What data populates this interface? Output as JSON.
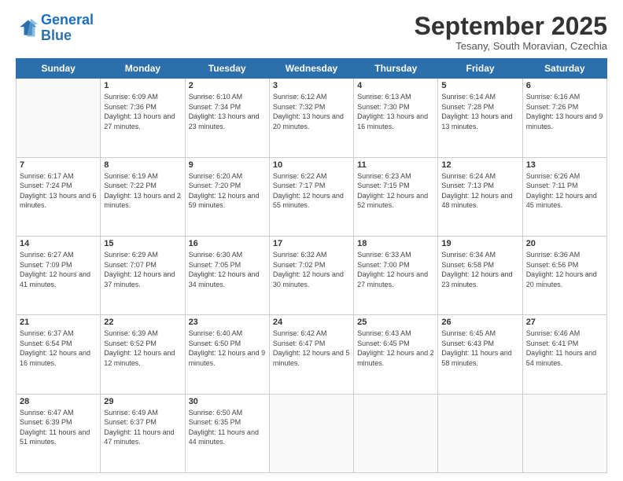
{
  "header": {
    "logo_line1": "General",
    "logo_line2": "Blue",
    "month": "September 2025",
    "location": "Tesany, South Moravian, Czechia"
  },
  "weekdays": [
    "Sunday",
    "Monday",
    "Tuesday",
    "Wednesday",
    "Thursday",
    "Friday",
    "Saturday"
  ],
  "weeks": [
    [
      {
        "day": "",
        "empty": true
      },
      {
        "day": "1",
        "sunrise": "Sunrise: 6:09 AM",
        "sunset": "Sunset: 7:36 PM",
        "daylight": "Daylight: 13 hours and 27 minutes."
      },
      {
        "day": "2",
        "sunrise": "Sunrise: 6:10 AM",
        "sunset": "Sunset: 7:34 PM",
        "daylight": "Daylight: 13 hours and 23 minutes."
      },
      {
        "day": "3",
        "sunrise": "Sunrise: 6:12 AM",
        "sunset": "Sunset: 7:32 PM",
        "daylight": "Daylight: 13 hours and 20 minutes."
      },
      {
        "day": "4",
        "sunrise": "Sunrise: 6:13 AM",
        "sunset": "Sunset: 7:30 PM",
        "daylight": "Daylight: 13 hours and 16 minutes."
      },
      {
        "day": "5",
        "sunrise": "Sunrise: 6:14 AM",
        "sunset": "Sunset: 7:28 PM",
        "daylight": "Daylight: 13 hours and 13 minutes."
      },
      {
        "day": "6",
        "sunrise": "Sunrise: 6:16 AM",
        "sunset": "Sunset: 7:26 PM",
        "daylight": "Daylight: 13 hours and 9 minutes."
      }
    ],
    [
      {
        "day": "7",
        "sunrise": "Sunrise: 6:17 AM",
        "sunset": "Sunset: 7:24 PM",
        "daylight": "Daylight: 13 hours and 6 minutes."
      },
      {
        "day": "8",
        "sunrise": "Sunrise: 6:19 AM",
        "sunset": "Sunset: 7:22 PM",
        "daylight": "Daylight: 13 hours and 2 minutes."
      },
      {
        "day": "9",
        "sunrise": "Sunrise: 6:20 AM",
        "sunset": "Sunset: 7:20 PM",
        "daylight": "Daylight: 12 hours and 59 minutes."
      },
      {
        "day": "10",
        "sunrise": "Sunrise: 6:22 AM",
        "sunset": "Sunset: 7:17 PM",
        "daylight": "Daylight: 12 hours and 55 minutes."
      },
      {
        "day": "11",
        "sunrise": "Sunrise: 6:23 AM",
        "sunset": "Sunset: 7:15 PM",
        "daylight": "Daylight: 12 hours and 52 minutes."
      },
      {
        "day": "12",
        "sunrise": "Sunrise: 6:24 AM",
        "sunset": "Sunset: 7:13 PM",
        "daylight": "Daylight: 12 hours and 48 minutes."
      },
      {
        "day": "13",
        "sunrise": "Sunrise: 6:26 AM",
        "sunset": "Sunset: 7:11 PM",
        "daylight": "Daylight: 12 hours and 45 minutes."
      }
    ],
    [
      {
        "day": "14",
        "sunrise": "Sunrise: 6:27 AM",
        "sunset": "Sunset: 7:09 PM",
        "daylight": "Daylight: 12 hours and 41 minutes."
      },
      {
        "day": "15",
        "sunrise": "Sunrise: 6:29 AM",
        "sunset": "Sunset: 7:07 PM",
        "daylight": "Daylight: 12 hours and 37 minutes."
      },
      {
        "day": "16",
        "sunrise": "Sunrise: 6:30 AM",
        "sunset": "Sunset: 7:05 PM",
        "daylight": "Daylight: 12 hours and 34 minutes."
      },
      {
        "day": "17",
        "sunrise": "Sunrise: 6:32 AM",
        "sunset": "Sunset: 7:02 PM",
        "daylight": "Daylight: 12 hours and 30 minutes."
      },
      {
        "day": "18",
        "sunrise": "Sunrise: 6:33 AM",
        "sunset": "Sunset: 7:00 PM",
        "daylight": "Daylight: 12 hours and 27 minutes."
      },
      {
        "day": "19",
        "sunrise": "Sunrise: 6:34 AM",
        "sunset": "Sunset: 6:58 PM",
        "daylight": "Daylight: 12 hours and 23 minutes."
      },
      {
        "day": "20",
        "sunrise": "Sunrise: 6:36 AM",
        "sunset": "Sunset: 6:56 PM",
        "daylight": "Daylight: 12 hours and 20 minutes."
      }
    ],
    [
      {
        "day": "21",
        "sunrise": "Sunrise: 6:37 AM",
        "sunset": "Sunset: 6:54 PM",
        "daylight": "Daylight: 12 hours and 16 minutes."
      },
      {
        "day": "22",
        "sunrise": "Sunrise: 6:39 AM",
        "sunset": "Sunset: 6:52 PM",
        "daylight": "Daylight: 12 hours and 12 minutes."
      },
      {
        "day": "23",
        "sunrise": "Sunrise: 6:40 AM",
        "sunset": "Sunset: 6:50 PM",
        "daylight": "Daylight: 12 hours and 9 minutes."
      },
      {
        "day": "24",
        "sunrise": "Sunrise: 6:42 AM",
        "sunset": "Sunset: 6:47 PM",
        "daylight": "Daylight: 12 hours and 5 minutes."
      },
      {
        "day": "25",
        "sunrise": "Sunrise: 6:43 AM",
        "sunset": "Sunset: 6:45 PM",
        "daylight": "Daylight: 12 hours and 2 minutes."
      },
      {
        "day": "26",
        "sunrise": "Sunrise: 6:45 AM",
        "sunset": "Sunset: 6:43 PM",
        "daylight": "Daylight: 11 hours and 58 minutes."
      },
      {
        "day": "27",
        "sunrise": "Sunrise: 6:46 AM",
        "sunset": "Sunset: 6:41 PM",
        "daylight": "Daylight: 11 hours and 54 minutes."
      }
    ],
    [
      {
        "day": "28",
        "sunrise": "Sunrise: 6:47 AM",
        "sunset": "Sunset: 6:39 PM",
        "daylight": "Daylight: 11 hours and 51 minutes."
      },
      {
        "day": "29",
        "sunrise": "Sunrise: 6:49 AM",
        "sunset": "Sunset: 6:37 PM",
        "daylight": "Daylight: 11 hours and 47 minutes."
      },
      {
        "day": "30",
        "sunrise": "Sunrise: 6:50 AM",
        "sunset": "Sunset: 6:35 PM",
        "daylight": "Daylight: 11 hours and 44 minutes."
      },
      {
        "day": "",
        "empty": true
      },
      {
        "day": "",
        "empty": true
      },
      {
        "day": "",
        "empty": true
      },
      {
        "day": "",
        "empty": true
      }
    ]
  ]
}
